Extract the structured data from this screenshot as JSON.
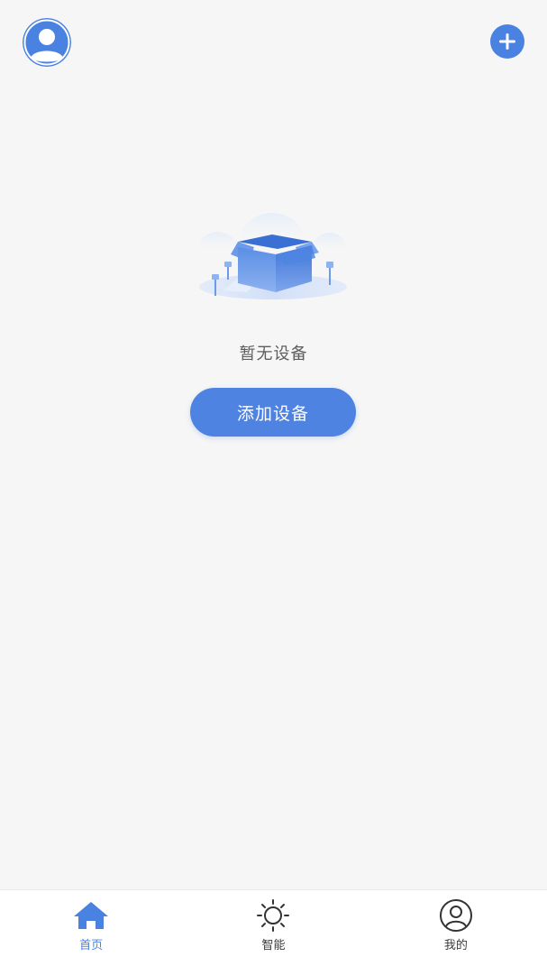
{
  "colors": {
    "accent": "#4a82e2",
    "background": "#f6f6f6",
    "text_muted": "#5d5d5d"
  },
  "header": {
    "avatar_icon": "user-avatar-icon",
    "add_icon": "plus-icon"
  },
  "empty_state": {
    "illustration": "empty-box-illustration",
    "message": "暂无设备",
    "add_device_label": "添加设备"
  },
  "bottom_nav": {
    "items": [
      {
        "label": "首页",
        "icon": "home-icon",
        "active": true
      },
      {
        "label": "智能",
        "icon": "sun-icon",
        "active": false
      },
      {
        "label": "我的",
        "icon": "profile-icon",
        "active": false
      }
    ]
  }
}
